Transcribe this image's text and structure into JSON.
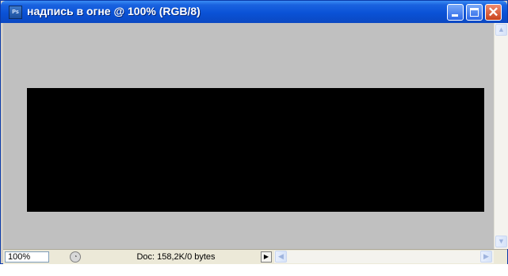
{
  "window": {
    "title": "надпись в огне @ 100% (RGB/8)",
    "app_icon_label": "Ps",
    "buttons": {
      "minimize_icon": "minimize-icon",
      "maximize_icon": "maximize-icon",
      "close_icon": "close-icon",
      "close_glyph": "✕"
    }
  },
  "document": {
    "canvas_color": "#000000",
    "pasteboard_color": "#c0c0c0"
  },
  "statusbar": {
    "zoom": "100%",
    "doc_info": "Doc: 158,2K/0 bytes",
    "menu_arrow": "▶"
  },
  "scrollbars": {
    "up_arrow": "▲",
    "down_arrow": "▼",
    "left_arrow": "◀",
    "right_arrow": "▶"
  },
  "colors": {
    "titlebar": "#0a52d6",
    "close_button": "#c8421c"
  }
}
